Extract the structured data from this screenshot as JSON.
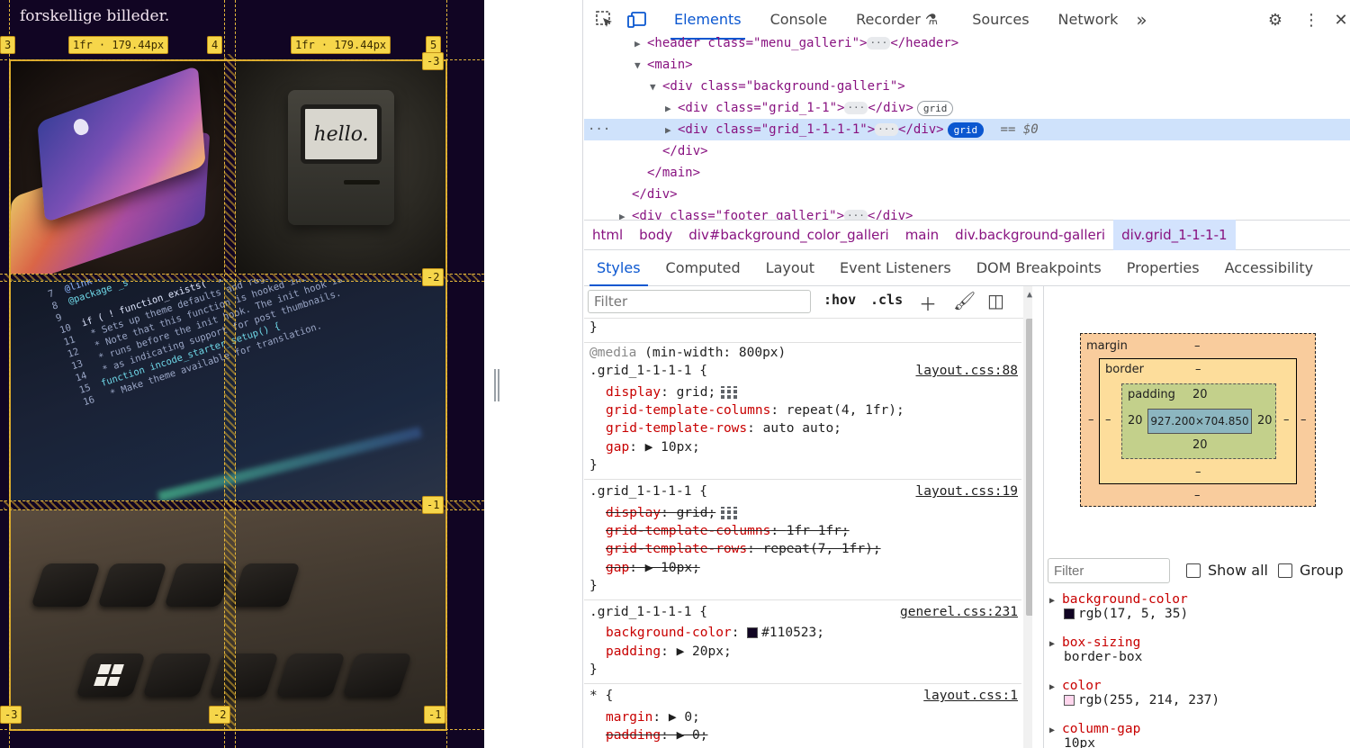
{
  "viewport": {
    "caption": "forskellige billeder.",
    "grid_badges": {
      "col3_top": "3",
      "col_track1": "1fr · 179.44px",
      "col4_top": "4",
      "col_track2": "1fr · 179.44px",
      "col5_top": "5",
      "row_m3": "-3",
      "row_m2": "-2",
      "row_m1": "-1",
      "bottom_m3": "-3",
      "bottom_m2": "-2",
      "bottom_m1": "-1"
    },
    "mac_screen_text": "hello.",
    "code_lines": [
      "@link https://developer.wordpress.org",
      "@package _s",
      "",
      "if ( ! function_exists( 'incode_starter_setup' ) ) :",
      " * Sets up theme defaults and registers support for various WordPress features.",
      " * Note that this function is hooked into the after_setup_theme hook, which",
      " * runs before the init hook. The init hook is too late for some features, such",
      " * as indicating support for post thumbnails.",
      "function incode_starter_setup() {",
      " * Make theme available for translation."
    ],
    "line_numbers": [
      "7",
      "8",
      "9",
      "10",
      "11",
      "12",
      "13",
      "14",
      "15",
      "16"
    ]
  },
  "devtools": {
    "tabs": [
      "Elements",
      "Console",
      "Recorder",
      "Sources",
      "Network"
    ],
    "more_tabs": "»",
    "dom": [
      {
        "indent": 3,
        "tri": "▶",
        "open": "<header class=\"menu_galleri\">",
        "close": "</header>"
      },
      {
        "indent": 3,
        "tri": "▼",
        "open": "<main>"
      },
      {
        "indent": 4,
        "tri": "▼",
        "open": "<div class=\"background-galleri\">"
      },
      {
        "indent": 5,
        "tri": "▶",
        "open": "<div class=\"grid_1-1\">",
        "close": "</div>",
        "pill": "grid"
      },
      {
        "indent": 5,
        "tri": "▶",
        "open": "<div class=\"grid_1-1-1-1\">",
        "close": "</div>",
        "pill": "grid",
        "selected": true,
        "suffix": "== $0"
      },
      {
        "indent": 4,
        "open": "</div>"
      },
      {
        "indent": 3,
        "open": "</main>"
      },
      {
        "indent": 2,
        "open": "</div>"
      },
      {
        "indent": 2,
        "tri": "▶",
        "open": "<div class=\"footer_galleri\">",
        "close": "</div>"
      }
    ],
    "breadcrumbs": [
      "html",
      "body",
      "div#background_color_galleri",
      "main",
      "div.background-galleri",
      "div.grid_1-1-1-1"
    ],
    "subtabs": [
      "Styles",
      "Computed",
      "Layout",
      "Event Listeners",
      "DOM Breakpoints",
      "Properties",
      "Accessibility"
    ],
    "styles": {
      "filter_placeholder": "Filter",
      "hov": ":hov",
      "cls": ".cls",
      "close_brace": "}",
      "media": "@media",
      "media_query": "(min-width: 800px)",
      "rule1": {
        "selector": ".grid_1-1-1-1 {",
        "source": "layout.css:88",
        "props": [
          [
            "display",
            "grid;"
          ],
          [
            "grid-template-columns",
            "repeat(4, 1fr);"
          ],
          [
            "grid-template-rows",
            "auto auto;"
          ],
          [
            "gap",
            "▶ 10px;"
          ]
        ]
      },
      "rule2": {
        "selector": ".grid_1-1-1-1 {",
        "source": "layout.css:19",
        "props": [
          [
            "display",
            "grid;"
          ],
          [
            "grid-template-columns",
            "1fr 1fr;"
          ],
          [
            "grid-template-rows",
            "repeat(7, 1fr);"
          ],
          [
            "gap",
            "▶ 10px;"
          ]
        ]
      },
      "rule3": {
        "selector": ".grid_1-1-1-1 {",
        "source": "generel.css:231",
        "props": [
          [
            "background-color",
            "#110523;"
          ],
          [
            "padding",
            "▶ 20px;"
          ]
        ]
      },
      "rule4": {
        "selector": "* {",
        "source": "layout.css:1",
        "props": [
          [
            "margin",
            "▶ 0;"
          ],
          [
            "padding",
            "▶ 0;"
          ]
        ]
      }
    },
    "box_model": {
      "margin_label": "margin",
      "margin_top": "–",
      "margin_bottom": "–",
      "margin_left": "–",
      "margin_right": "–",
      "border_label": "border",
      "border_top": "–",
      "border_bottom": "–",
      "border_left": "–",
      "border_right": "–",
      "padding_label": "padding",
      "padding_top": "20",
      "padding_bottom": "20",
      "padding_left": "20",
      "padding_right": "20",
      "content": "927.200×704.850"
    },
    "computed": {
      "filter_placeholder": "Filter",
      "show_all": "Show all",
      "group": "Group",
      "rows": [
        {
          "prop": "background-color",
          "value": "rgb(17, 5, 35)",
          "swatch": "#110523"
        },
        {
          "prop": "box-sizing",
          "value": "border-box"
        },
        {
          "prop": "color",
          "value": "rgb(255, 214, 237)",
          "swatch": "#ffd6ed"
        },
        {
          "prop": "column-gap",
          "value": "10px"
        }
      ]
    }
  },
  "colors": {
    "page_bg": "#110523",
    "grid_overlay": "#e2b53c",
    "accent": "#0b57d0"
  }
}
